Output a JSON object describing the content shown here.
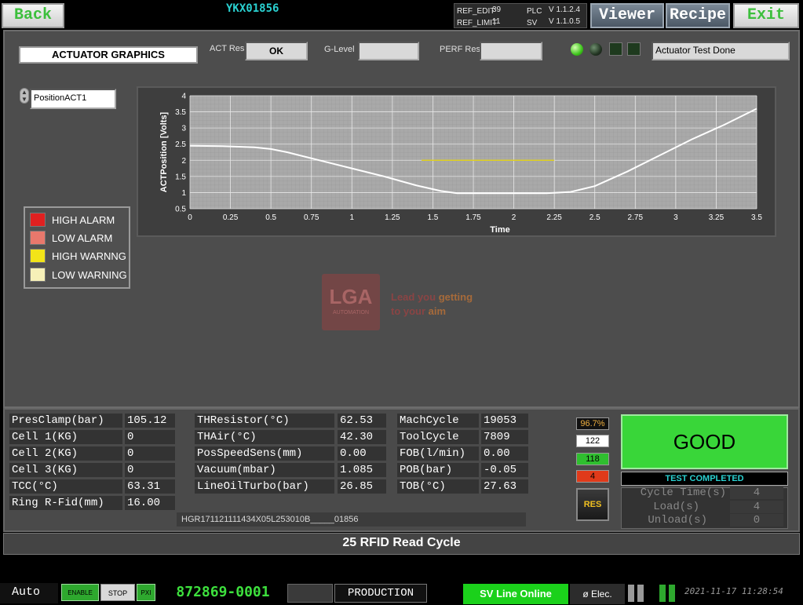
{
  "header": {
    "back_label": "Back",
    "code": "YKX01856",
    "ref_edit_label": "REF_EDIT",
    "ref_edit_value": "39",
    "ref_limit_label": "REF_LIMIT",
    "ref_limit_value": "11",
    "plc_label": "PLC",
    "plc_version": "V 1.1.2.4",
    "sv_label": "SV",
    "sv_version": "V 1.1.0.5",
    "viewer_label": "Viewer",
    "recipe_label": "Recipe",
    "exit_label": "Exit"
  },
  "panel": {
    "title": "ACTUATOR GRAPHICS",
    "act_res_label": "ACT Res",
    "act_res_value": "OK",
    "g_level_label": "G-Level",
    "g_level_value": "",
    "perf_res_label": "PERF Res",
    "perf_res_value": "",
    "status_message": "Actuator Test Done",
    "selector_value": "PositionACT1"
  },
  "legend": [
    {
      "label": "HIGH ALARM",
      "color": "#e02020"
    },
    {
      "label": "LOW ALARM",
      "color": "#e8786c"
    },
    {
      "label": "HIGH WARNNG",
      "color": "#f2e418"
    },
    {
      "label": "LOW WARNING",
      "color": "#f6f0b8"
    }
  ],
  "watermark": {
    "logo": "LGA",
    "logo_sub": "AUTOMATION",
    "tagline1_a": "Lead you",
    "tagline1_b": " getting",
    "tagline2_a": "to your",
    "tagline2_b": " aim"
  },
  "chart_data": {
    "type": "line",
    "xlabel": "Time",
    "ylabel": "ACTPosition [Volts]",
    "xlim": [
      0,
      3.5
    ],
    "ylim": [
      0.5,
      4
    ],
    "xticks": [
      "0",
      "0.25",
      "0.5",
      "0.75",
      "1",
      "1.25",
      "1.5",
      "1.75",
      "2",
      "2.25",
      "2.5",
      "2.75",
      "3",
      "3.25",
      "3.5"
    ],
    "yticks": [
      "0.5",
      "1",
      "1.5",
      "2",
      "2.5",
      "3",
      "3.5",
      "4"
    ],
    "grid": true,
    "series": [
      {
        "color": "#ffffff",
        "x": [
          0,
          0.2,
          0.4,
          0.5,
          0.6,
          0.8,
          1.0,
          1.2,
          1.4,
          1.55,
          1.65,
          1.8,
          2.0,
          2.2,
          2.35,
          2.5,
          2.7,
          2.9,
          3.1,
          3.3,
          3.5
        ],
        "y": [
          2.45,
          2.44,
          2.4,
          2.35,
          2.25,
          2.0,
          1.75,
          1.5,
          1.22,
          1.05,
          0.98,
          0.98,
          0.98,
          0.98,
          1.02,
          1.2,
          1.65,
          2.15,
          2.65,
          3.1,
          3.6
        ]
      },
      {
        "color": "#e0d020",
        "x": [
          1.43,
          2.25
        ],
        "y": [
          2.0,
          2.0
        ]
      }
    ]
  },
  "data_col1": [
    {
      "label": "PresClamp(bar)",
      "value": "105.12"
    },
    {
      "label": "Cell 1(KG)",
      "value": "0"
    },
    {
      "label": "Cell 2(KG)",
      "value": "0"
    },
    {
      "label": "Cell 3(KG)",
      "value": "0"
    },
    {
      "label": "TCC(°C)",
      "value": "63.31"
    },
    {
      "label": "Ring R-Fid(mm)",
      "value": "16.00"
    }
  ],
  "data_col2": [
    {
      "label": "THResistor(°C)",
      "value": "62.53"
    },
    {
      "label": "THAir(°C)",
      "value": "42.30"
    },
    {
      "label": "PosSpeedSens(mm)",
      "value": "0.00"
    },
    {
      "label": "Vacuum(mbar)",
      "value": "1.085"
    },
    {
      "label": "LineOilTurbo(bar)",
      "value": "26.85"
    }
  ],
  "data_col3": [
    {
      "label": "MachCycle",
      "value": "19053"
    },
    {
      "label": "ToolCycle",
      "value": "7809"
    },
    {
      "label": "FOB(l/min)",
      "value": "0.00"
    },
    {
      "label": "POB(bar)",
      "value": "-0.05"
    },
    {
      "label": "TOB(°C)",
      "value": "27.63"
    }
  ],
  "serial": "HGR171121111434X05L253010B_____01856",
  "counters": {
    "percent": "96.7%",
    "total": "122",
    "good": "118",
    "bad": "4",
    "res_label": "RES"
  },
  "result": {
    "label": "GOOD",
    "status": "TEST COMPLETED",
    "cycle_time_label": "Cycle Time(s)",
    "cycle_time_value": "4",
    "load_label": "Load(s)",
    "load_value": "4",
    "unload_label": "Unload(s)",
    "unload_value": "0"
  },
  "status_bar": "25 RFID Read Cycle",
  "footer": {
    "mode": "Auto",
    "enable": "ENABLE",
    "stop": "STOP",
    "pxi": "PXI",
    "part_number": "872869-0001",
    "production": "PRODUCTION",
    "sv_line": "SV Line Online",
    "elec": "ø Elec.",
    "datetime": "2021-11-17 11:28:54"
  }
}
